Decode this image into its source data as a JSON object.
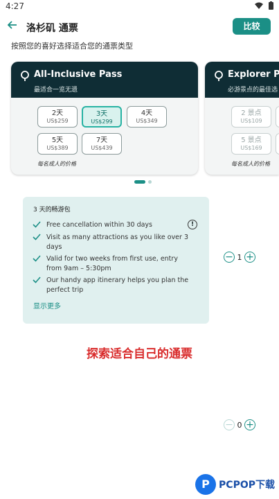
{
  "status_bar": {
    "time": "4:27"
  },
  "header": {
    "title": "洛杉矶 通票",
    "compare_label": "比较",
    "subtitle": "按照您的喜好选择适合您的通票类型"
  },
  "pass_cards": [
    {
      "title": "All-Inclusive Pass",
      "subtitle": "最适合一览无遗",
      "options": [
        {
          "duration": "2天",
          "price": "US$259"
        },
        {
          "duration": "3天",
          "price": "US$299",
          "selected": true
        },
        {
          "duration": "4天",
          "price": "US$349"
        },
        {
          "duration": "5天",
          "price": "US$389"
        },
        {
          "duration": "7天",
          "price": "US$439"
        }
      ],
      "price_note": "每名成人的价格"
    },
    {
      "title": "Explorer Pass",
      "subtitle": "必游景点的最佳选",
      "options": [
        {
          "duration": "2 景点",
          "price": "US$109"
        },
        {
          "duration": "5 景点",
          "price": "US$169"
        }
      ],
      "price_note": "每名成人的价格"
    }
  ],
  "details": {
    "title": "3 天的畅游包",
    "features": [
      "Free cancellation within 30 days",
      "Visit as many attractions as you like over 3 days",
      "Valid for two weeks from first use, entry from 9am – 5:30pm",
      "Our handy app itinerary helps you plan the perfect trip"
    ],
    "show_more": "显示更多"
  },
  "steppers": [
    {
      "value": "1"
    },
    {
      "value": "0"
    }
  ],
  "promo_text": "探索适合自己的通票",
  "watermark": {
    "text": "PCPOP下载"
  },
  "colors": {
    "accent": "#1b8f86",
    "card_header": "#0f2d35",
    "promo": "#d92c2c"
  }
}
